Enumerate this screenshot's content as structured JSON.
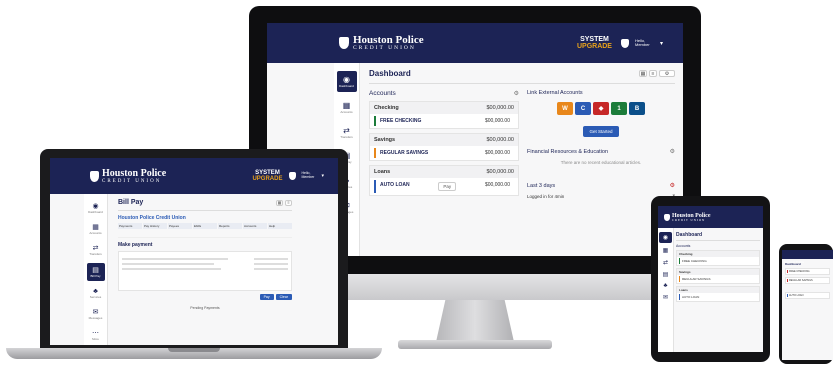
{
  "brand": {
    "name": "Houston Police",
    "sub": "CREDIT UNION"
  },
  "system_upgrade": {
    "line1": "SYSTEM",
    "line2": "UPGRADE"
  },
  "user_menu": {
    "label": "Hello, Member"
  },
  "nav": [
    {
      "label": "Dashboard",
      "icon": "gauge-icon"
    },
    {
      "label": "Accounts",
      "icon": "bank-icon"
    },
    {
      "label": "Transfers",
      "icon": "transfer-icon"
    },
    {
      "label": "Bill Pay",
      "icon": "bill-icon"
    },
    {
      "label": "Services",
      "icon": "services-icon"
    },
    {
      "label": "Messages",
      "icon": "message-icon"
    },
    {
      "label": "More",
      "icon": "more-icon"
    }
  ],
  "dashboard": {
    "title": "Dashboard",
    "accounts_heading": "Accounts",
    "checking": {
      "heading": "Checking",
      "name": "FREE CHECKING",
      "balance": "$00,000.00"
    },
    "savings": {
      "heading": "Savings",
      "name": "REGULAR SAVINGS",
      "balance": "$00,000.00"
    },
    "loans": {
      "heading": "Loans",
      "name": "AUTO LOAN",
      "balance": "$00,000.00",
      "pay_label": "Pay"
    },
    "link_accounts_heading": "Link External Accounts",
    "get_started": "Get Started",
    "finance_heading": "Financial Resources & Education",
    "finance_empty": "There are no recent educational articles.",
    "last_login_heading": "Last 3 days",
    "logged_in_text": "Logged in for 4min"
  },
  "billpay": {
    "title": "Bill Pay",
    "heading": "Houston Police Credit Union",
    "tabs": [
      "Payments",
      "Pay History",
      "Payees",
      "Ebills",
      "Reports",
      "Accounts",
      "Help"
    ],
    "make_payment": "Make payment",
    "pending": "Pending Payments",
    "pay_btn": "Pay",
    "cancel_btn": "Clear"
  },
  "colors": {
    "navy": "#1c2355",
    "gold": "#e8a21b",
    "accent_blue": "#2b5bb5"
  }
}
